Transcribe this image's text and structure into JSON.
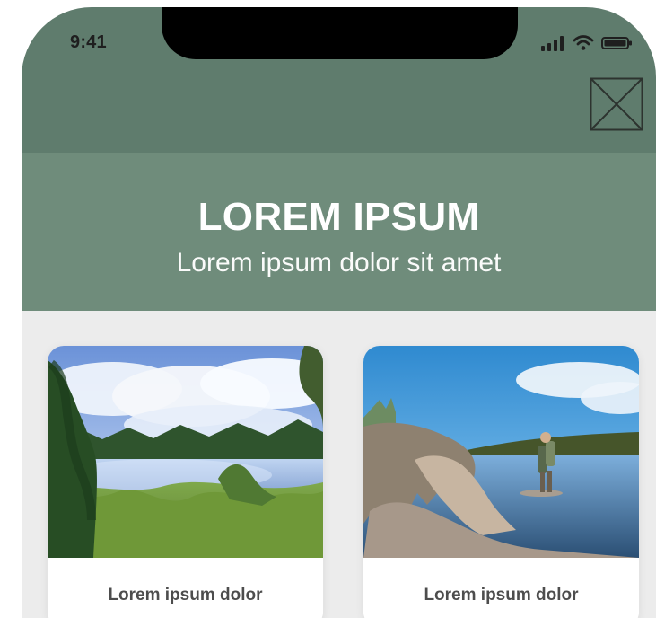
{
  "status_bar": {
    "time": "9:41",
    "icons": [
      "signal-icon",
      "wifi-icon",
      "battery-icon"
    ]
  },
  "header": {
    "title": "LOREM IPSUM",
    "subtitle": "Lorem ipsum dolor sit amet",
    "action_icon": "image-placeholder-icon"
  },
  "cards": [
    {
      "caption": "Lorem ipsum dolor",
      "image_subject": "lake-landscape"
    },
    {
      "caption": "Lorem ipsum dolor",
      "image_subject": "hiker-at-lake"
    }
  ],
  "colors": {
    "status_bar": "#5f7c6d",
    "hero": "#6f8c7b",
    "content_bg": "#ececec",
    "card_bg": "#ffffff",
    "text_dark": "#4d4d4d",
    "text_light": "#ffffff"
  }
}
